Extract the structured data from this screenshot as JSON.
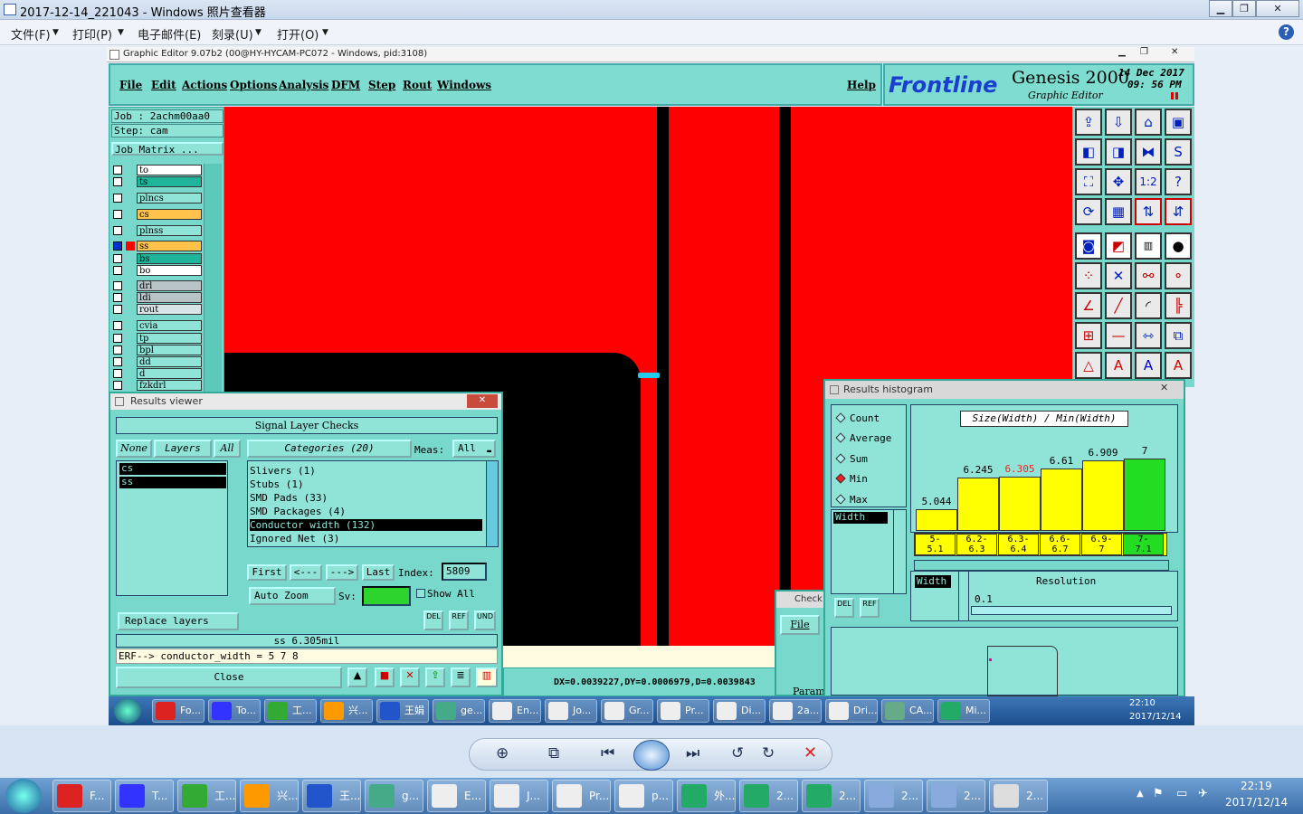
{
  "photo_viewer": {
    "title": "2017-12-14_221043 - Windows 照片查看器",
    "menu": [
      "文件(F)",
      "打印(P)",
      "电子邮件(E)",
      "刻录(U)",
      "打开(O)"
    ]
  },
  "graphic_editor": {
    "window_title": "Graphic Editor 9.07b2 (00@HY-HYCAM-PC072 - Windows, pid:3108)",
    "menu": [
      "File",
      "Edit",
      "Actions",
      "Options",
      "Analysis",
      "DFM",
      "Step",
      "Rout",
      "Windows"
    ],
    "help": "Help",
    "brand": "Frontline",
    "product": "Genesis 2000",
    "product_sub": "Graphic Editor",
    "date": "14 Dec 2017",
    "time": "09: 56  PM",
    "job_label": "Job  :  2achm00aa0",
    "step_label": "Step:  cam",
    "job_matrix": "Job Matrix ...",
    "layers": [
      {
        "name": "to",
        "color": "#ffffff",
        "checked": false
      },
      {
        "name": "ts",
        "color": "#1fb59a",
        "checked": false
      },
      {
        "name": "plncs",
        "color": "#8fe3d7",
        "checked": false
      },
      {
        "name": "cs",
        "color": "#ffc24a",
        "checked": false
      },
      {
        "name": "plnss",
        "color": "#8fe3d7",
        "checked": false
      },
      {
        "name": "ss",
        "color": "#ffc24a",
        "checked": true
      },
      {
        "name": "bs",
        "color": "#1fb59a",
        "checked": false
      },
      {
        "name": "bo",
        "color": "#ffffff",
        "checked": false
      },
      {
        "name": "drl",
        "color": "#b8c4c8",
        "checked": false
      },
      {
        "name": "ldi",
        "color": "#b8c4c8",
        "checked": false
      },
      {
        "name": "rout",
        "color": "#d8e4e6",
        "checked": false
      },
      {
        "name": "cvia",
        "color": "#8fe3d7",
        "checked": false
      },
      {
        "name": "tp",
        "color": "#8fe3d7",
        "checked": false
      },
      {
        "name": "bpl",
        "color": "#8fe3d7",
        "checked": false
      },
      {
        "name": "dd",
        "color": "#8fe3d7",
        "checked": false
      },
      {
        "name": "d",
        "color": "#8fe3d7",
        "checked": false
      },
      {
        "name": "fzkdrl",
        "color": "#8fe3d7",
        "checked": false
      }
    ],
    "status_text": "DX=0.0039227,DY=0.0006979,D=0.0039843"
  },
  "results_viewer": {
    "title": "Results viewer",
    "heading": "Signal Layer Checks",
    "tab_none": "None",
    "tab_layers": "Layers",
    "tab_all": "All",
    "categories_label": "Categories (20)",
    "meas_label": "Meas:",
    "meas_value": "All",
    "layer_list": [
      "cs",
      "ss"
    ],
    "categories": [
      "Slivers (1)",
      "Stubs (1)",
      "SMD Pads (33)",
      "SMD Packages (4)",
      "Conductor width (132)",
      "Ignored Net (3)"
    ],
    "selected_category": "Conductor width (132)",
    "nav": {
      "first": "First",
      "prev": "<---",
      "next": "--->",
      "last": "Last",
      "index_label": "Index:",
      "index_value": "5809"
    },
    "auto_zoom": "Auto Zoom",
    "sv_label": "Sv:",
    "show_all": "Show All",
    "replace_layers": "Replace layers",
    "measurement": "ss 6.305mil",
    "erf_line": "ERF--> conductor_width = 5 7 8",
    "close": "Close"
  },
  "histogram": {
    "title": "Results histogram",
    "options": [
      "Count",
      "Average",
      "Sum",
      "Min",
      "Max"
    ],
    "selected_option": "Min",
    "width_item": "Width",
    "chart_title": "Size(Width) / Min(Width)",
    "resolution_label": "Resolution",
    "resolution_value": "0.1",
    "width_tab": "Width"
  },
  "chart_data": {
    "type": "bar",
    "title": "Size(Width) / Min(Width)",
    "categories": [
      "5-5.1",
      "6.2-6.3",
      "6.3-6.4",
      "6.6-6.7",
      "6.9-7",
      "7-7.1"
    ],
    "category_labels": [
      [
        "5-",
        "5.1"
      ],
      [
        "6.2-",
        "6.3"
      ],
      [
        "6.3-",
        "6.4"
      ],
      [
        "6.6-",
        "6.7"
      ],
      [
        "6.9-",
        "7"
      ],
      [
        "7-",
        "7.1"
      ]
    ],
    "values": [
      5.044,
      6.245,
      6.305,
      6.61,
      6.909,
      7
    ],
    "value_labels": [
      "5.044",
      "6.245",
      "6.305",
      "6.61",
      "6.909",
      "7"
    ],
    "ylim": [
      4.2,
      7.2
    ],
    "bar_colors": [
      "#ffff00",
      "#ffff00",
      "#ffff00",
      "#ffff00",
      "#ffff00",
      "#22dd22"
    ],
    "highlight_color": "#ff2020"
  },
  "inner_taskbar": [
    "Fo...",
    "To...",
    "工...",
    "兴...",
    "王娟",
    "ge...",
    "En...",
    "Jo...",
    "Gr...",
    "Pr...",
    "Di...",
    "2a...",
    "Dri...",
    "CA...",
    "Mi..."
  ],
  "inner_clock": {
    "time": "22:10",
    "date": "2017/12/14"
  },
  "outer_taskbar": [
    "F...",
    "T...",
    "工...",
    "兴...",
    "王...",
    "g...",
    "E...",
    "J...",
    "Pr...",
    "p...",
    "外...",
    "2...",
    "2...",
    "2...",
    "2...",
    "2..."
  ],
  "outer_clock": {
    "time": "22:19",
    "date": "2017/12/14"
  },
  "check_window": {
    "title": "Check",
    "file": "File",
    "param": "Param"
  }
}
